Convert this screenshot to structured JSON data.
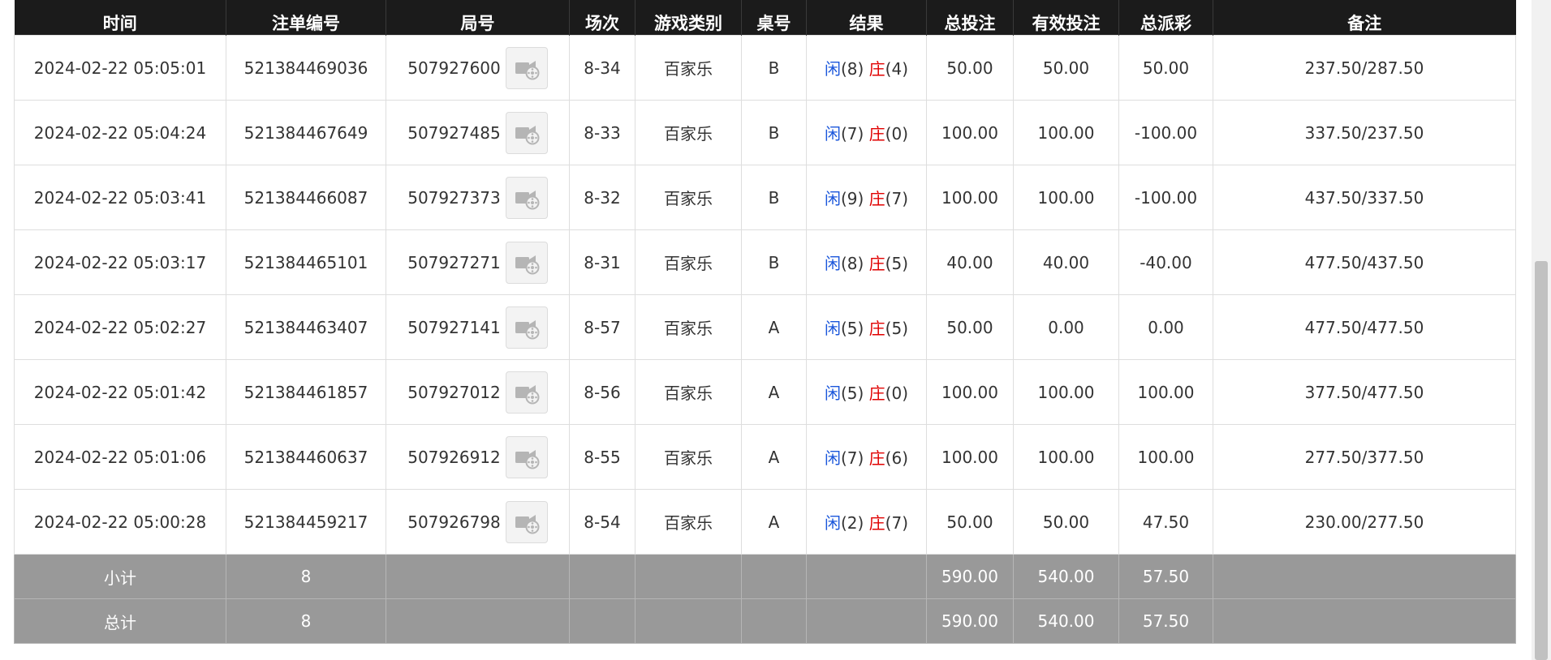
{
  "headers": [
    "时间",
    "注单编号",
    "局号",
    "场次",
    "游戏类别",
    "桌号",
    "结果",
    "总投注",
    "有效投注",
    "总派彩",
    "备注"
  ],
  "result_labels": {
    "player": "闲",
    "banker": "庄"
  },
  "rows": [
    {
      "time": "2024-02-22 05:05:01",
      "bet_id": "521384469036",
      "round": "507927600",
      "session": "8-34",
      "game": "百家乐",
      "table": "B",
      "player_score": "(8)",
      "banker_score": "(4)",
      "total_bet": "50.00",
      "valid_bet": "50.00",
      "payout": "50.00",
      "payout_negative": false,
      "remark": "237.50/287.50"
    },
    {
      "time": "2024-02-22 05:04:24",
      "bet_id": "521384467649",
      "round": "507927485",
      "session": "8-33",
      "game": "百家乐",
      "table": "B",
      "player_score": "(7)",
      "banker_score": "(0)",
      "total_bet": "100.00",
      "valid_bet": "100.00",
      "payout": "-100.00",
      "payout_negative": true,
      "remark": "337.50/237.50"
    },
    {
      "time": "2024-02-22 05:03:41",
      "bet_id": "521384466087",
      "round": "507927373",
      "session": "8-32",
      "game": "百家乐",
      "table": "B",
      "player_score": "(9)",
      "banker_score": "(7)",
      "total_bet": "100.00",
      "valid_bet": "100.00",
      "payout": "-100.00",
      "payout_negative": true,
      "remark": "437.50/337.50"
    },
    {
      "time": "2024-02-22 05:03:17",
      "bet_id": "521384465101",
      "round": "507927271",
      "session": "8-31",
      "game": "百家乐",
      "table": "B",
      "player_score": "(8)",
      "banker_score": "(5)",
      "total_bet": "40.00",
      "valid_bet": "40.00",
      "payout": "-40.00",
      "payout_negative": true,
      "remark": "477.50/437.50"
    },
    {
      "time": "2024-02-22 05:02:27",
      "bet_id": "521384463407",
      "round": "507927141",
      "session": "8-57",
      "game": "百家乐",
      "table": "A",
      "player_score": "(5)",
      "banker_score": "(5)",
      "total_bet": "50.00",
      "valid_bet": "0.00",
      "payout": "0.00",
      "payout_negative": false,
      "remark": "477.50/477.50"
    },
    {
      "time": "2024-02-22 05:01:42",
      "bet_id": "521384461857",
      "round": "507927012",
      "session": "8-56",
      "game": "百家乐",
      "table": "A",
      "player_score": "(5)",
      "banker_score": "(0)",
      "total_bet": "100.00",
      "valid_bet": "100.00",
      "payout": "100.00",
      "payout_negative": false,
      "remark": "377.50/477.50"
    },
    {
      "time": "2024-02-22 05:01:06",
      "bet_id": "521384460637",
      "round": "507926912",
      "session": "8-55",
      "game": "百家乐",
      "table": "A",
      "player_score": "(7)",
      "banker_score": "(6)",
      "total_bet": "100.00",
      "valid_bet": "100.00",
      "payout": "100.00",
      "payout_negative": false,
      "remark": "277.50/377.50"
    },
    {
      "time": "2024-02-22 05:00:28",
      "bet_id": "521384459217",
      "round": "507926798",
      "session": "8-54",
      "game": "百家乐",
      "table": "A",
      "player_score": "(2)",
      "banker_score": "(7)",
      "total_bet": "50.00",
      "valid_bet": "50.00",
      "payout": "47.50",
      "payout_negative": false,
      "remark": "230.00/277.50"
    }
  ],
  "subtotal": {
    "label": "小计",
    "count": "8",
    "total_bet": "590.00",
    "valid_bet": "540.00",
    "payout": "57.50"
  },
  "grand_total": {
    "label": "总计",
    "count": "8",
    "total_bet": "590.00",
    "valid_bet": "540.00",
    "payout": "57.50"
  },
  "icons": {
    "replay": "video-replay-icon"
  },
  "colors": {
    "header_bg": "#1b1b1b",
    "summary_bg": "#999999",
    "bet_blue": "#1a56db",
    "loss_red": "#e00000"
  }
}
